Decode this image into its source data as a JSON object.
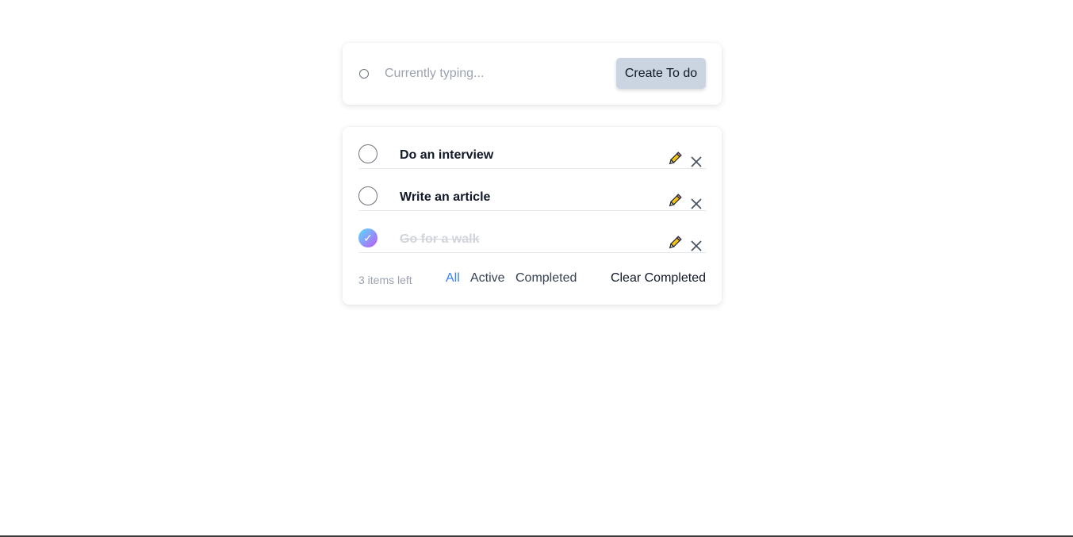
{
  "input": {
    "placeholder": "Currently typing...",
    "value": "",
    "create_label": "Create To do"
  },
  "todos": [
    {
      "text": "Do an interview",
      "completed": false
    },
    {
      "text": "Write an article",
      "completed": false
    },
    {
      "text": "Go for a walk",
      "completed": true
    }
  ],
  "checkmark": "✓",
  "footer": {
    "items_left": "3 items left",
    "filters": [
      "All",
      "Active",
      "Completed"
    ],
    "active_filter": "All",
    "clear_label": "Clear Completed"
  },
  "colors": {
    "accent": "#3b82f6",
    "button_bg": "#cbd5e1",
    "check_gradient_start": "#57ddff",
    "check_gradient_end": "#c058f3"
  },
  "icons": {
    "edit": "pencil-icon",
    "delete": "close-icon",
    "new_item": "circle-icon"
  }
}
